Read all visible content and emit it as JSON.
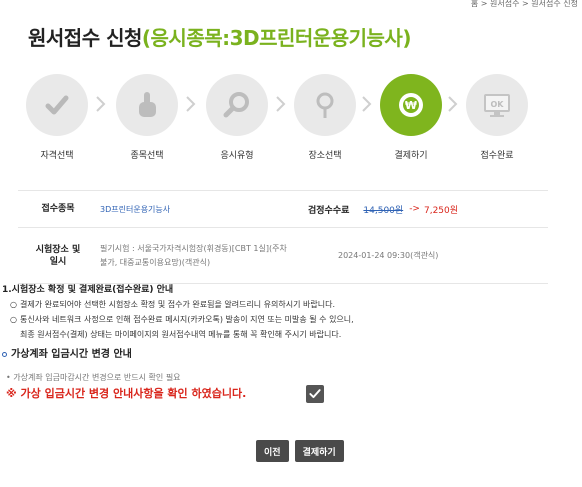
{
  "breadcrumb": "홈 > 원서접수 > 원서접수 신청",
  "page": {
    "title_main": "원서접수 신청",
    "title_sub": "(응시종목:3D프린터운용기능사)"
  },
  "steps": [
    {
      "label": "자격선택",
      "icon": "check-icon",
      "active": false
    },
    {
      "label": "종목선택",
      "icon": "hand-pointer-icon",
      "active": false
    },
    {
      "label": "응시유형",
      "icon": "magnifier-icon",
      "active": false
    },
    {
      "label": "장소선택",
      "icon": "location-pin-icon",
      "active": false
    },
    {
      "label": "결제하기",
      "icon": "won-coin-icon",
      "active": true
    },
    {
      "label": "접수완료",
      "icon": "ok-monitor-icon",
      "active": false
    }
  ],
  "info": {
    "subject_label": "접수종목",
    "subject_value": "3D프린터운용기능사",
    "fee_label": "검정수수료",
    "fee_old": "14,500원",
    "fee_arrow": "->",
    "fee_new": "7,250원",
    "place_label_1": "시험장소 및",
    "place_label_2": "일시",
    "place_line_1": "필기시험 : 서울국가자격시험장(휘경동)[CBT 1실](주차",
    "place_line_2": "불가, 대중교통이용요망)(객관식)",
    "datetime": "2024-01-24 09:30(객관식)"
  },
  "notice": {
    "title": "1.시험장소 확정 및 결제완료(접수완료) 안내",
    "bullet": "○",
    "item1": "결제가 완료되어야 선택한 시험장소 확정 및 접수가 완료됨을 알려드리니 유의하시기 바랍니다.",
    "item2": "통신사와 네트워크 사정으로 인해 접수완료 메시지(카카오톡) 발송이 지연 또는 미발송 될 수 있으니,",
    "item2_cont": "최종 원서접수(결제) 상태는 마이페이지의 원서접수내역 메뉴를 통해 꼭 확인해 주시기 바랍니다."
  },
  "virtual": {
    "section_title": "가상계좌 입금시간 변경 안내",
    "note": "• 가상계좌 입금마감시간 변경으로 반드시 확인 필요",
    "confirm_text": "※ 가상 입금시간 변경 안내사항을 확인 하였습니다.",
    "checked": true
  },
  "buttons": {
    "prev": "이전",
    "pay": "결제하기"
  },
  "colors": {
    "accent_green": "#7fb51e",
    "red": "#d9261c",
    "blue": "#2f62b4"
  }
}
